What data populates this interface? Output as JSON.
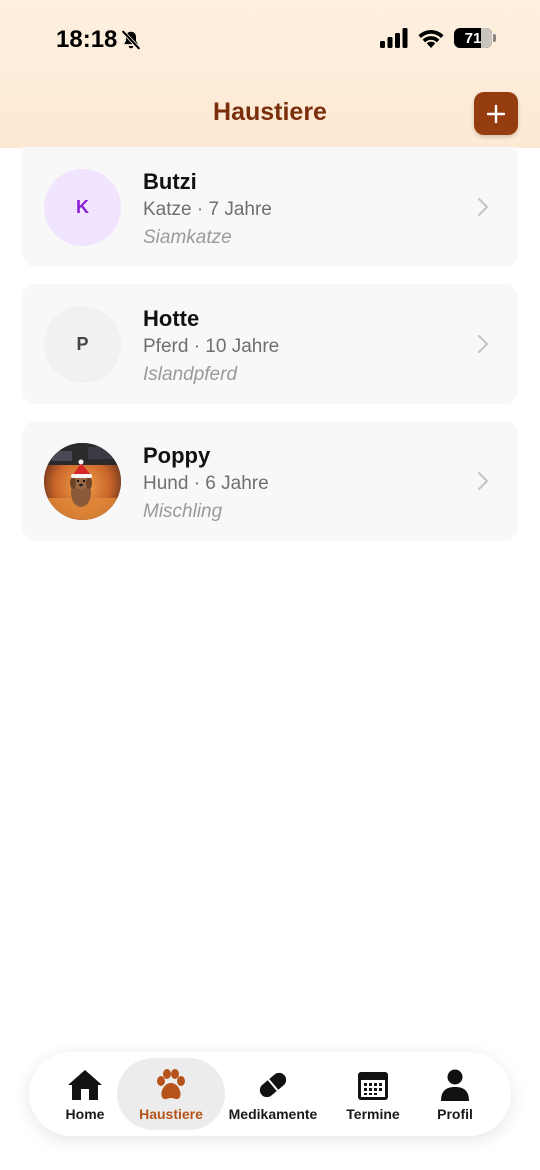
{
  "status_bar": {
    "time": "18:18",
    "battery_percent": "71",
    "icons": [
      "bell-slash-icon",
      "cellular-signal-icon",
      "wifi-icon",
      "battery-icon"
    ]
  },
  "header": {
    "title": "Haustiere",
    "add_icon": "plus-icon"
  },
  "pets": [
    {
      "initial": "K",
      "name": "Butzi",
      "meta": "Katze · 7 Jahre",
      "breed": "Siamkatze",
      "avatar_bg": "#f1e4fe",
      "avatar_color": "#8a1fd6"
    },
    {
      "initial": "P",
      "name": "Hotte",
      "meta": "Pferd · 10 Jahre",
      "breed": "Islandpferd",
      "avatar_bg": "#f1f1f1",
      "avatar_color": "#444444"
    },
    {
      "initial": "",
      "name": "Poppy",
      "meta": "Hund · 6 Jahre",
      "breed": "Mischling",
      "avatar": "dog-photo"
    }
  ],
  "tabs": [
    {
      "label": "Home",
      "icon": "house-icon",
      "active": false
    },
    {
      "label": "Haustiere",
      "icon": "paw-icon",
      "active": true
    },
    {
      "label": "Medikamente",
      "icon": "pill-icon",
      "active": false
    },
    {
      "label": "Termine",
      "icon": "calendar-icon",
      "active": false
    },
    {
      "label": "Profil",
      "icon": "person-icon",
      "active": false
    }
  ],
  "colors": {
    "accent": "#963d0f",
    "title": "#7a2e0b",
    "active_tab_label": "#b5531a",
    "header_bg": "#fdf0df"
  }
}
